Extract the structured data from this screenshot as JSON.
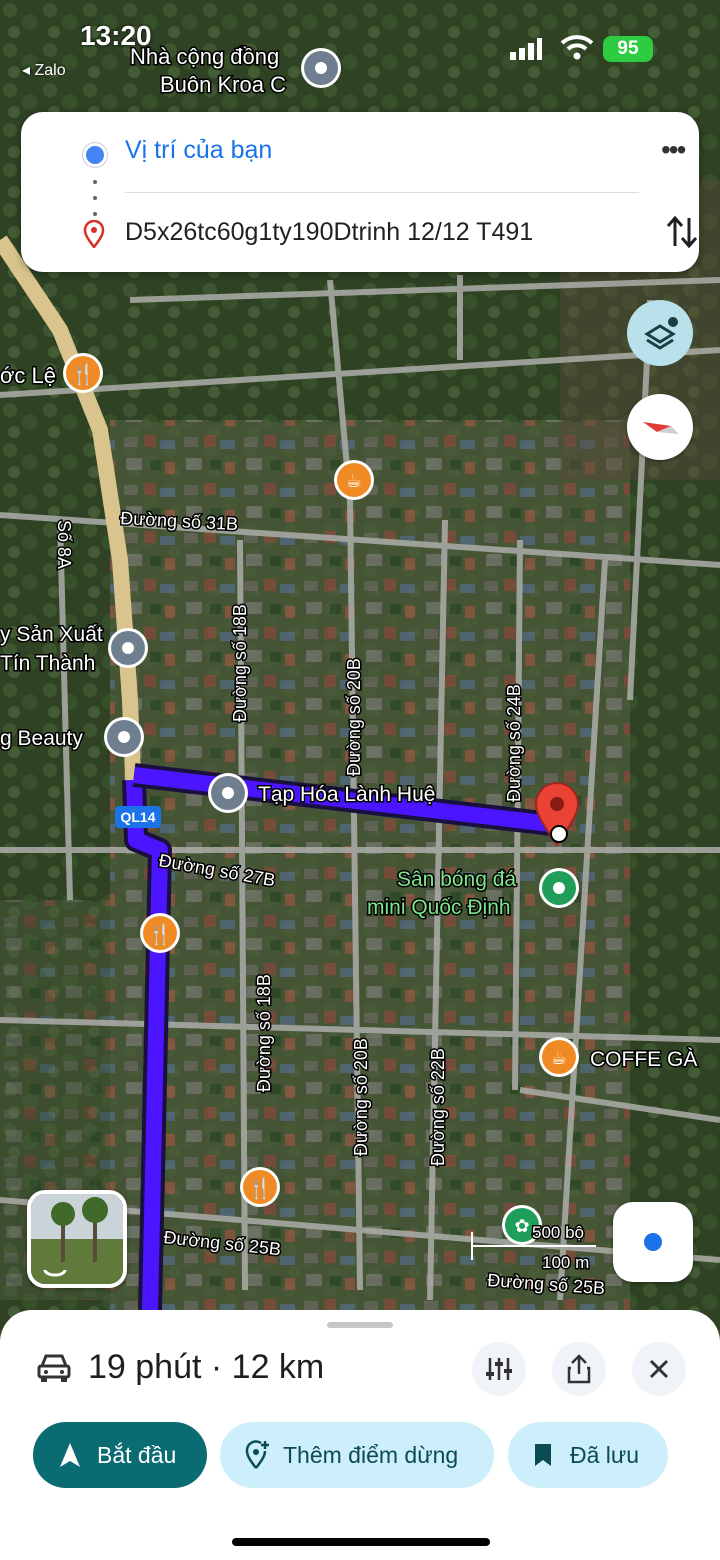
{
  "status_bar": {
    "time": "13:20",
    "back_app": "◂ Zalo",
    "battery": "95"
  },
  "route_card": {
    "origin": "Vị trí của bạn",
    "destination": "D5x26tc60g1ty190Dtrinh 12/12 T491",
    "menu_icon": "more-vert-icon",
    "swap_icon": "swap-icon"
  },
  "map": {
    "places": {
      "nha_cong_dong": "Nhà cộng đồng",
      "buon_kroa": "Buôn Kroa C",
      "oc_le": "ớc Lệ",
      "san_xuat": "y Sản Xuất",
      "tin_thanh": "Tín Thành",
      "beauty": "g Beauty",
      "tap_hoa": "Tạp Hóa Lành Huệ",
      "san_bong_1": "Sân bóng đá",
      "san_bong_2": "mini Quốc Định",
      "coffe": "COFFE GÀ"
    },
    "roads": {
      "s31b": "Đường số 31B",
      "s8a": "Số 8A",
      "s18b_top": "Đường số 18B",
      "s20b_top": "Đường số 20B",
      "s24b": "Đường số 24B",
      "ql14": "QL14",
      "s27b": "Đường số 27B",
      "s18b_bottom": "Đường số 18B",
      "s20b_bottom": "Đường số 20B",
      "s22b": "Đường số 22B",
      "s25b_left": "Đường số 25B",
      "s25b_right": "Đường số 25B"
    },
    "scale": {
      "imperial": "500 bộ",
      "metric": "100 m"
    },
    "route_color": "#4b16ff"
  },
  "bottom_sheet": {
    "summary": "19 phút · 12 km",
    "start_label": "Bắt đầu",
    "add_stop_label": "Thêm điểm dừng",
    "saved_label": "Đã lưu"
  }
}
